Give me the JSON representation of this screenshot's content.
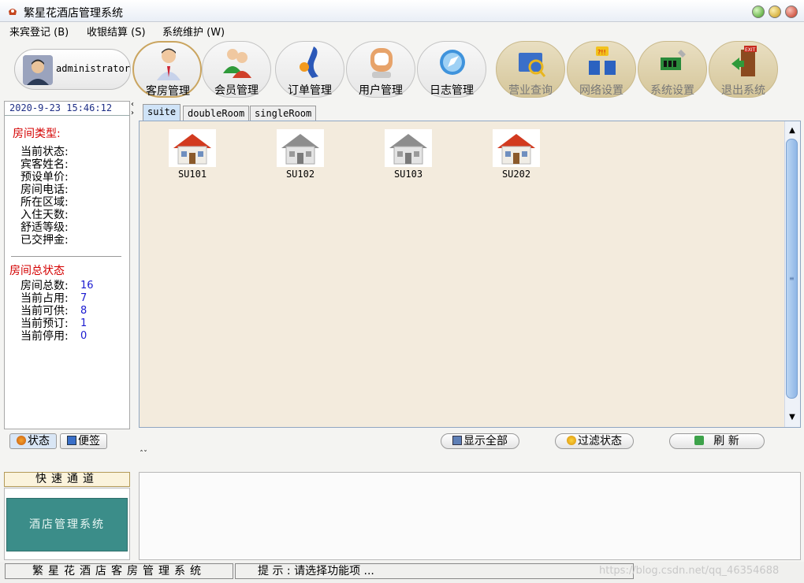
{
  "window": {
    "title": "繁星花酒店管理系统"
  },
  "menu": [
    {
      "label": "来宾登记 (B)"
    },
    {
      "label": "收银结算 (S)"
    },
    {
      "label": "系统维护 (W)"
    }
  ],
  "user": {
    "name": "administrator"
  },
  "toolbar": [
    {
      "label": "客房管理",
      "icon": "person-manager-icon"
    },
    {
      "label": "会员管理",
      "icon": "members-icon"
    },
    {
      "label": "订单管理",
      "icon": "order-icon"
    },
    {
      "label": "用户管理",
      "icon": "user-icon"
    },
    {
      "label": "日志管理",
      "icon": "compass-icon"
    },
    {
      "label": "营业查询",
      "icon": "folder-search-icon"
    },
    {
      "label": "网络设置",
      "icon": "network-icon"
    },
    {
      "label": "系统设置",
      "icon": "hardware-icon"
    },
    {
      "label": "退出系统",
      "icon": "exit-door-icon"
    }
  ],
  "left": {
    "datetime": "2020-9-23 15:46:12",
    "room_type_heading": "房间类型:",
    "room_fields": [
      "当前状态:",
      "宾客姓名:",
      "预设单价:",
      "房间电话:",
      "所在区域:",
      "入住天数:",
      "舒适等级:",
      "已交押金:"
    ],
    "status_heading": "房间总状态",
    "status_rows": [
      {
        "label": "房间总数:",
        "value": "16"
      },
      {
        "label": "当前占用:",
        "value": "7"
      },
      {
        "label": "当前可供:",
        "value": "8"
      },
      {
        "label": "当前预订:",
        "value": "1"
      },
      {
        "label": "当前停用:",
        "value": "0"
      }
    ]
  },
  "tabs": [
    {
      "label": "suite",
      "active": true
    },
    {
      "label": "doubleRoom",
      "active": false
    },
    {
      "label": "singleRoom",
      "active": false
    }
  ],
  "rooms": [
    {
      "label": "SU101",
      "occupied": true
    },
    {
      "label": "SU102",
      "occupied": false
    },
    {
      "label": "SU103",
      "occupied": false
    },
    {
      "label": "SU202",
      "occupied": true
    }
  ],
  "bottom_tabs": [
    {
      "label": "状态",
      "icon": "status-icon"
    },
    {
      "label": "便签",
      "icon": "note-icon"
    }
  ],
  "actions": {
    "show_all": "显示全部",
    "filter": "过滤状态",
    "refresh": "刷 新",
    "collapse_arrows": "ˆˇ"
  },
  "quick": {
    "heading": "快速通道",
    "button": "酒店管理系统"
  },
  "status": {
    "left": "繁星花酒店客房管理系统",
    "hint": "提 示 :  请选择功能项 ...",
    "watermark": "https://blog.csdn.net/qq_46354688"
  },
  "colors": {
    "occupied_roof": "#d23a1f",
    "vacant_roof": "#8d8d8d",
    "accent_red": "#d40000",
    "value_blue": "#1a1ad0"
  }
}
